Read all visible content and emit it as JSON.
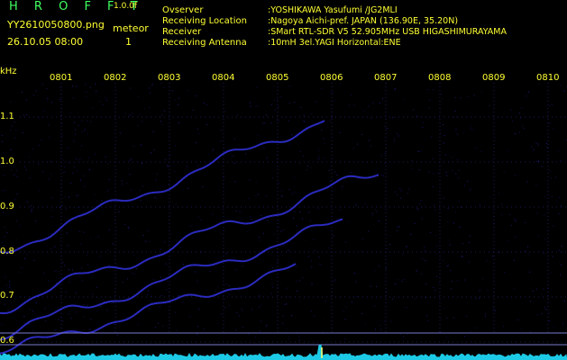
{
  "header": {
    "brand": "H R O F F T",
    "version": "1.0.0f",
    "filename": "YY2610050800.png",
    "datetime": "26.10.05 08:00",
    "meteor_label": "meteor",
    "meteor_count": "1"
  },
  "info": [
    {
      "key": "Ovserver",
      "value": ":YOSHIKAWA Yasufumi /JG2MLI"
    },
    {
      "key": "Receiving Location",
      "value": ":Nagoya Aichi-pref. JAPAN (136.90E, 35.20N)"
    },
    {
      "key": "Receiver",
      "value": ":SMart RTL-SDR V5 52.905MHz USB HIGASHIMURAYAMA"
    },
    {
      "key": "Receiving Antenna",
      "value": ":10mH 3el.YAGI Horizontal:ENE"
    }
  ],
  "axis": {
    "unit": "kHz",
    "freq_labels": [
      "1.1",
      "1.0",
      "0.9",
      "0.8",
      "0.7",
      "0.6"
    ],
    "time_labels": [
      "0801",
      "0802",
      "0803",
      "0804",
      "0805",
      "0806",
      "0807",
      "0808",
      "0809",
      "0810"
    ]
  },
  "colors": {
    "text": "#ffff33",
    "brand": "#40ff60",
    "trace": "#3a3aff",
    "grid": "#1a1a55",
    "bottom_trace": "#20e0ff"
  }
}
